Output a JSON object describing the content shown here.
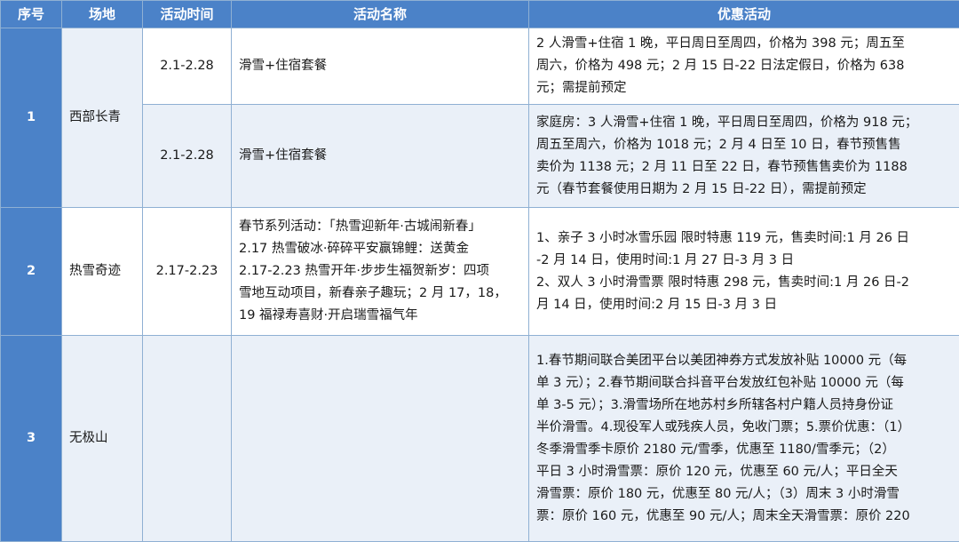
{
  "headers": {
    "no": "序号",
    "venue": "场地",
    "period": "活动时间",
    "name": "活动名称",
    "offer": "优惠活动"
  },
  "rows": [
    {
      "no": "1",
      "venue": "西部长青",
      "subrows": [
        {
          "period": "2.1-2.28",
          "name": "滑雪+住宿套餐",
          "offer_lines": [
            "2 人滑雪+住宿 1 晚，平日周日至周四，价格为 398 元；周五至",
            "周六，价格为 498 元；2 月 15 日-22 日法定假日，价格为 638",
            "元；需提前预定"
          ]
        },
        {
          "period": "2.1-2.28",
          "name": "滑雪+住宿套餐",
          "offer_lines": [
            "家庭房：3 人滑雪+住宿 1 晚，平日周日至周四，价格为 918 元；",
            "周五至周六，价格为 1018 元；2 月 4 日至 10 日，春节预售售",
            "卖价为 1138 元；2 月 11 日至 22 日，春节预售售卖价为 1188",
            "元（春节套餐使用日期为 2 月 15 日-22 日），需提前预定"
          ]
        }
      ]
    },
    {
      "no": "2",
      "venue": "热雪奇迹",
      "period": "2.17-2.23",
      "name_lines": [
        "春节系列活动：「热雪迎新年·古城闹新春」",
        "2.17  热雪破冰·碎碎平安赢锦鲤：送黄金",
        "2.17-2.23  热雪开年·步步生福贺新岁：四项",
        "雪地互动项目，新春亲子趣玩；2 月 17，18，",
        "19  福禄寿喜财·开启瑞雪福气年"
      ],
      "offer_lines": [
        "1、亲子 3 小时冰雪乐园  限时特惠 119 元，售卖时间:1 月 26 日",
        "-2 月 14 日，使用时间:1 月 27 日-3 月 3 日",
        "2、双人 3 小时滑雪票  限时特惠 298 元，售卖时间:1 月 26 日-2",
        "月 14 日，使用时间:2 月 15 日-3 月 3 日"
      ]
    },
    {
      "no": "3",
      "venue": "无极山",
      "period": "",
      "name": "",
      "offer_lines": [
        "1.春节期间联合美团平台以美团神券方式发放补贴 10000 元（每",
        "单 3 元）；2.春节期间联合抖音平台发放红包补贴 10000 元（每",
        "单 3-5 元）；3.滑雪场所在地苏村乡所辖各村户籍人员持身份证",
        "半价滑雪。4.现役军人或残疾人员，免收门票；5.票价优惠：（1）",
        "冬季滑雪季卡原价 2180 元/雪季，优惠至 1180/雪季元；（2）",
        "平日 3 小时滑雪票：原价 120 元，优惠至 60 元/人；平日全天",
        "滑雪票：原价 180 元，优惠至 80  元/人；（3）周末 3 小时滑雪",
        "票：原价 160 元，优惠至 90 元/人；周末全天滑雪票：原价 220"
      ]
    }
  ]
}
